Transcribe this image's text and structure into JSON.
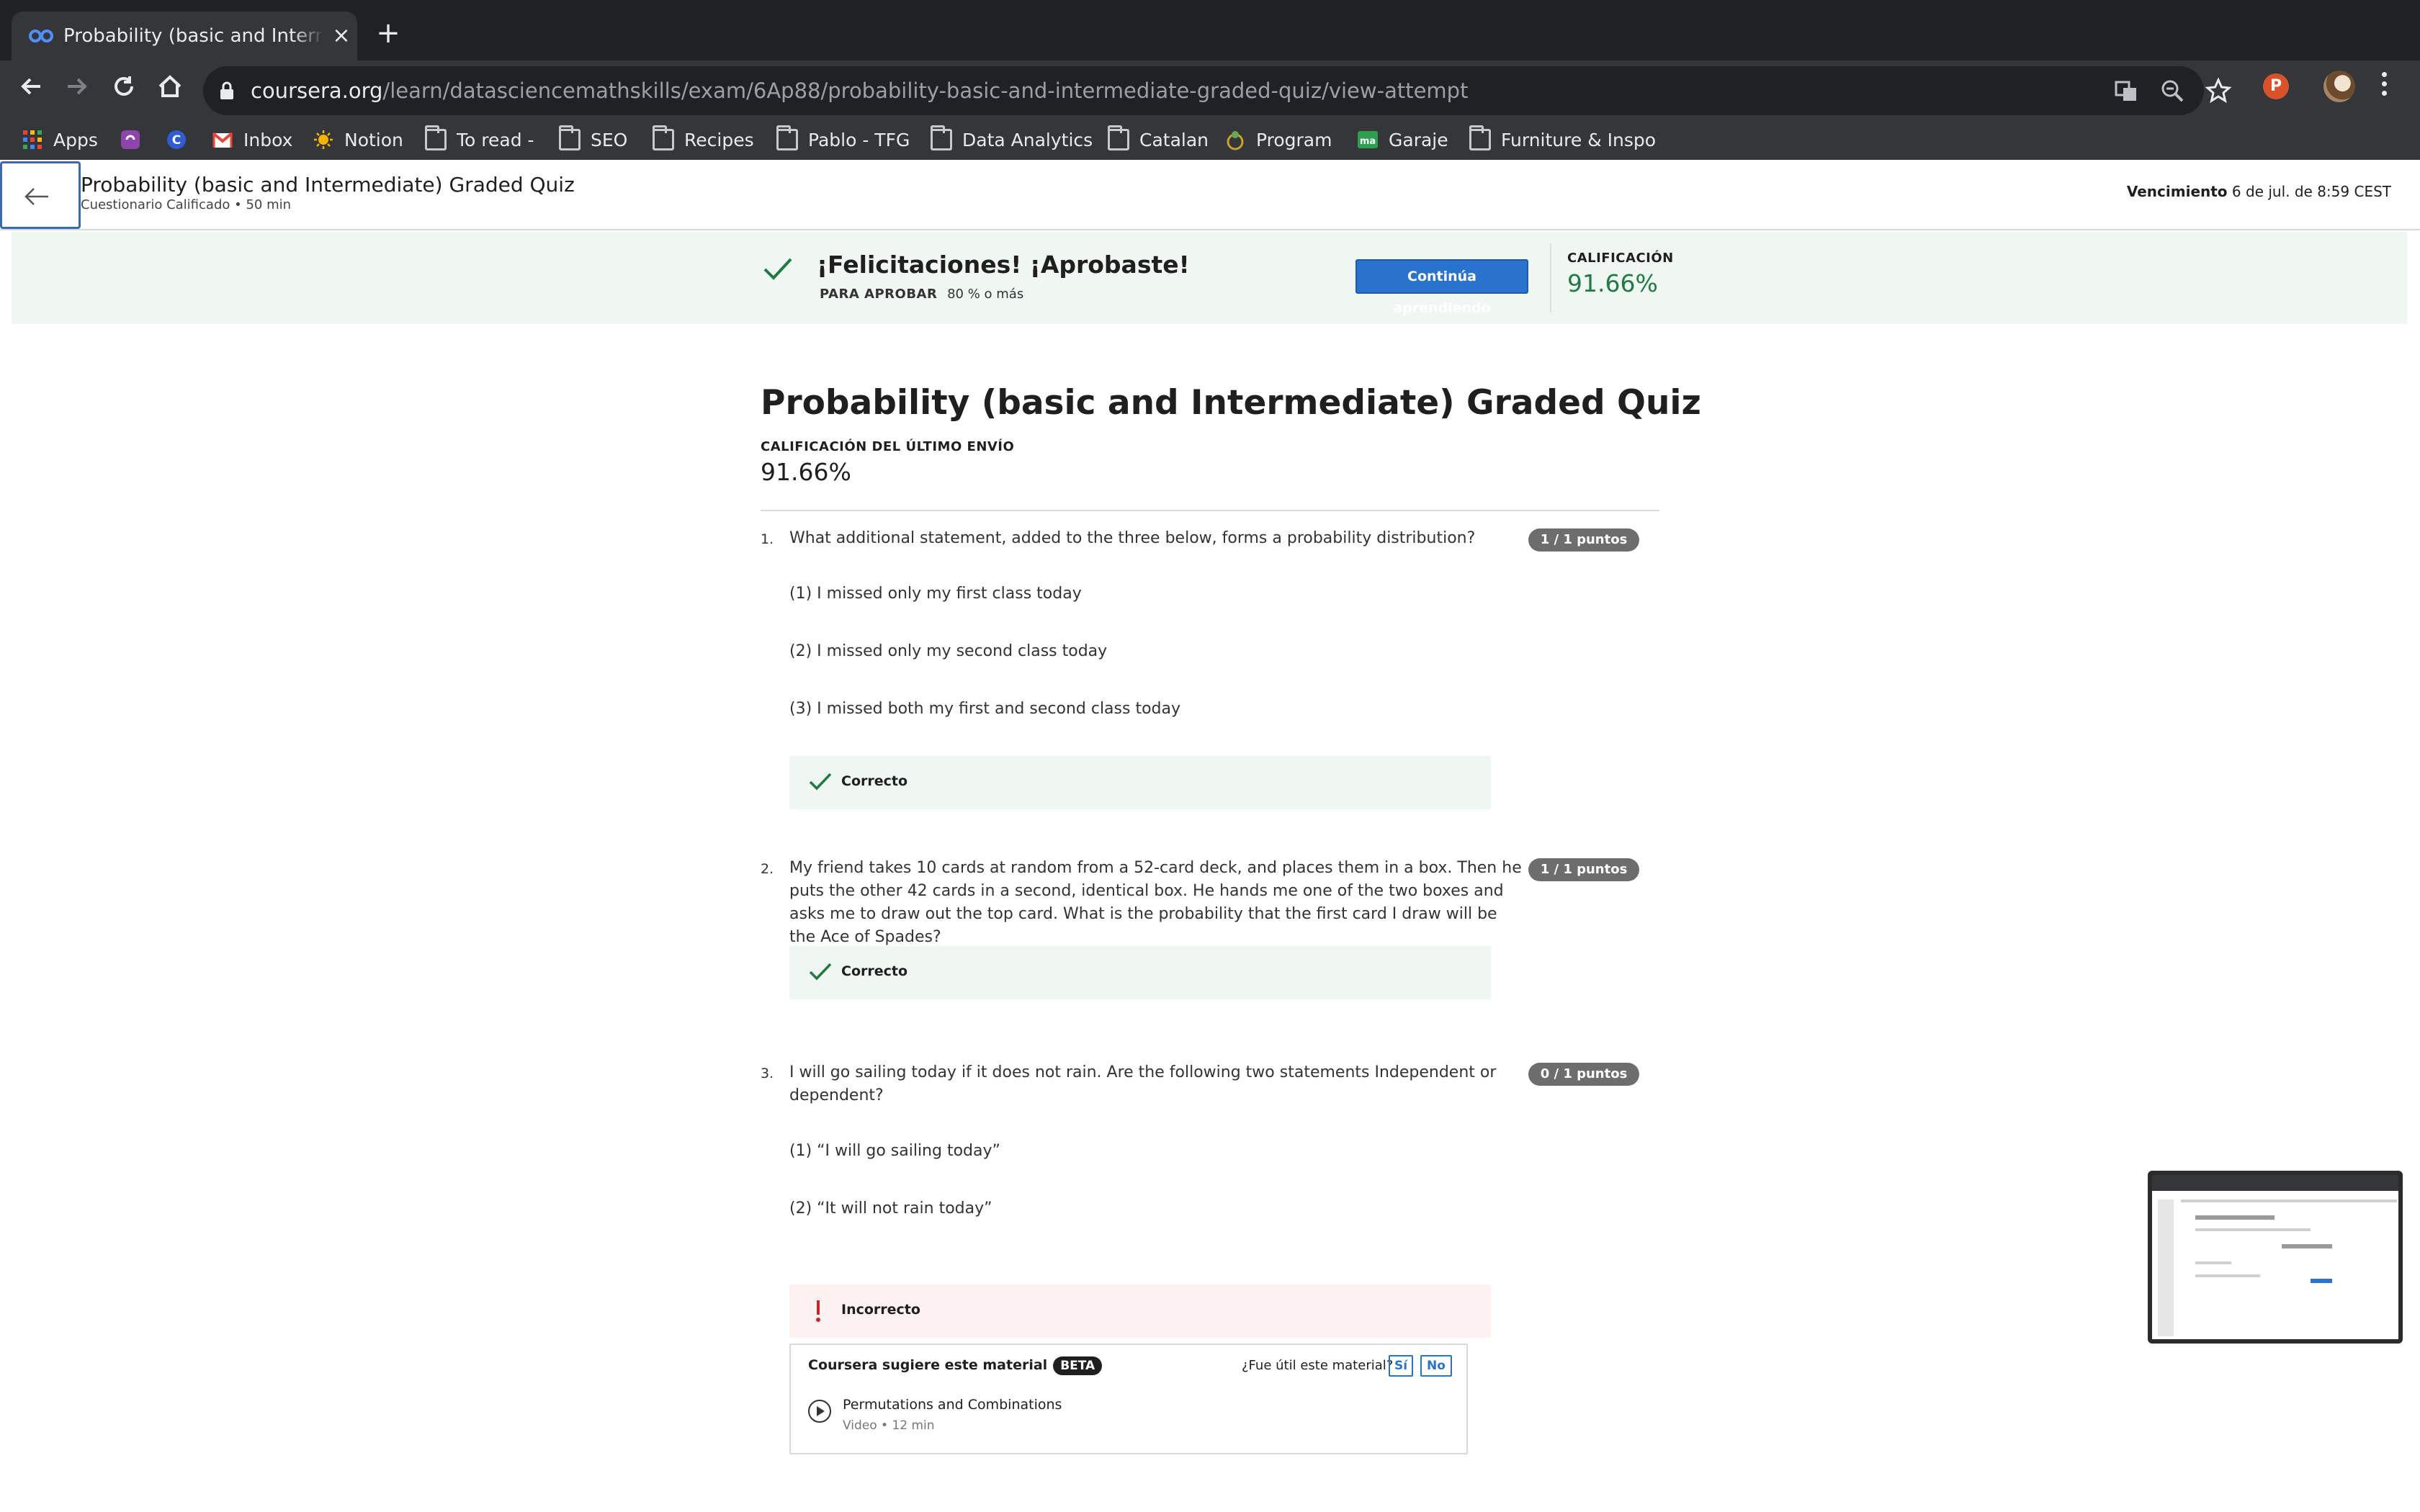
{
  "browser": {
    "tab_title": "Probability (basic and Intermediate) Graded Quiz",
    "url_host": "coursera.org",
    "url_path": "/learn/datasciencemathskills/exam/6Ap88/probability-basic-and-intermediate-graded-quiz/view-attempt",
    "profile_letter": "P",
    "bookmarks": [
      {
        "label": "Apps",
        "icon": "apps-grid-icon"
      },
      {
        "label": "",
        "icon": "extension-icon"
      },
      {
        "label": "",
        "icon": "bookmark-c-icon"
      },
      {
        "label": "Inbox",
        "icon": "gmail-icon"
      },
      {
        "label": "Notion",
        "icon": "sun-icon"
      },
      {
        "label": "To read -",
        "icon": "folder-icon"
      },
      {
        "label": "SEO",
        "icon": "folder-icon"
      },
      {
        "label": "Recipes",
        "icon": "folder-icon"
      },
      {
        "label": "Pablo - TFG",
        "icon": "folder-icon"
      },
      {
        "label": "Data Analytics",
        "icon": "folder-icon"
      },
      {
        "label": "Catalan",
        "icon": "folder-icon"
      },
      {
        "label": "Program",
        "icon": "program-icon"
      },
      {
        "label": "Garaje",
        "icon": "ma-icon"
      },
      {
        "label": "Furniture & Inspo",
        "icon": "folder-icon"
      }
    ]
  },
  "header": {
    "title": "Probability (basic and Intermediate) Graded Quiz",
    "subtitle": "Cuestionario Calificado • 50 min",
    "due_label": "Vencimiento",
    "due_value": "6 de jul. de 8:59 CEST"
  },
  "banner": {
    "title": "¡Felicitaciones! ¡Aprobaste!",
    "pass_label": "PARA APROBAR",
    "pass_value": "80 % o más",
    "continue_label": "Continúa aprendiendo",
    "grade_label": "CALIFICACIÓN",
    "grade_value": "91.66%"
  },
  "quiz": {
    "title": "Probability (basic and Intermediate) Graded Quiz",
    "last_label": "CALIFICACIÓN DEL ÚLTIMO ENVÍO",
    "last_value": "91.66%",
    "questions": [
      {
        "number": "1.",
        "text": "What additional statement, added to the three below, forms a probability distribution?",
        "points": "1 / 1 puntos",
        "options": [
          "(1) I missed only my first class today",
          "(2) I missed only my second class today",
          "(3) I missed both my first and second class today"
        ],
        "feedback": "Correcto"
      },
      {
        "number": "2.",
        "text": "My friend takes 10 cards at random from a 52-card deck, and places them in a box. Then he puts the other 42 cards in a second, identical box. He hands me one of the two boxes and asks me to draw out the top card. What is the probability that the first card I draw will be the Ace of Spades?",
        "points": "1 / 1 puntos",
        "feedback": "Correcto"
      },
      {
        "number": "3.",
        "text": "I will go sailing today if it does not rain. Are the following two statements Independent or dependent?",
        "points": "0 / 1 puntos",
        "options": [
          "(1) “I will go sailing today”",
          "(2) “It will not rain today”"
        ],
        "feedback": "Incorrecto"
      }
    ],
    "suggestion": {
      "title": "Coursera sugiere este material",
      "beta": "BETA",
      "question": "¿Fue útil este material?",
      "yes": "Sí",
      "no": "No",
      "item_title": "Permutations and Combinations",
      "item_meta": "Video • 12 min"
    }
  },
  "colors": {
    "brand_blue": "#2a73cc",
    "success_green": "#1f7a43",
    "error_red": "#c62828"
  }
}
